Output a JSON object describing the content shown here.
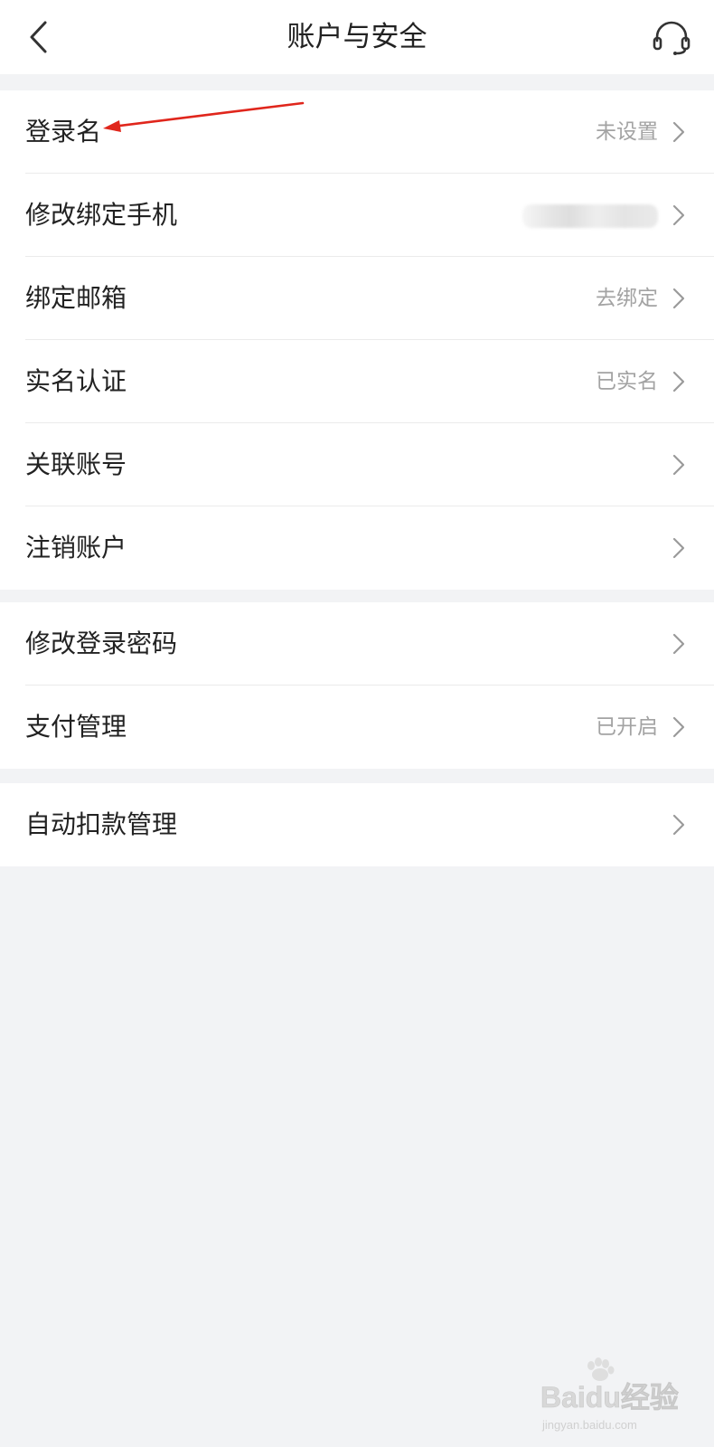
{
  "header": {
    "title": "账户与安全",
    "back_icon": "chevron-left-icon",
    "service_icon": "headset-icon"
  },
  "groups": [
    {
      "items": [
        {
          "label": "登录名",
          "value": "未设置"
        },
        {
          "label": "修改绑定手机",
          "value": ""
        },
        {
          "label": "绑定邮箱",
          "value": "去绑定"
        },
        {
          "label": "实名认证",
          "value": "已实名"
        },
        {
          "label": "关联账号",
          "value": ""
        },
        {
          "label": "注销账户",
          "value": ""
        }
      ]
    },
    {
      "items": [
        {
          "label": "修改登录密码",
          "value": ""
        },
        {
          "label": "支付管理",
          "value": "已开启"
        }
      ]
    },
    {
      "items": [
        {
          "label": "自动扣款管理",
          "value": ""
        }
      ]
    }
  ],
  "annotation": {
    "color": "#e0261c"
  },
  "watermark": {
    "brand": "Baidu经验",
    "site": "jingyan.baidu.com"
  },
  "colors": {
    "background": "#f2f3f5",
    "text": "#222222",
    "secondary_text": "#a3a3a3"
  }
}
